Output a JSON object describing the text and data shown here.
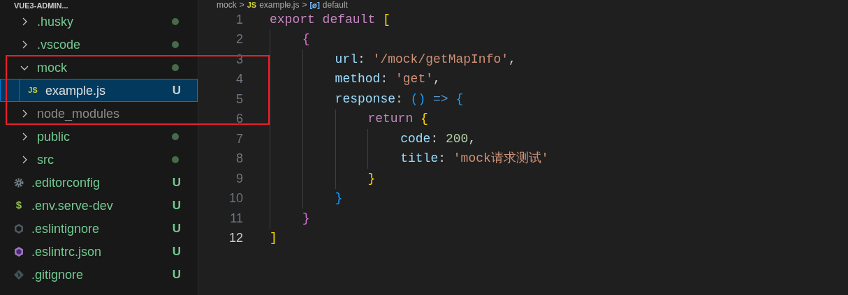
{
  "explorer": {
    "title": "VUE3-ADMIN...",
    "items": [
      {
        "name": ".husky",
        "kind": "folder",
        "expanded": false,
        "modified_dot": true,
        "ignored": false,
        "selected": false
      },
      {
        "name": ".vscode",
        "kind": "folder",
        "expanded": false,
        "modified_dot": true,
        "ignored": false,
        "selected": false
      },
      {
        "name": "mock",
        "kind": "folder",
        "expanded": true,
        "modified_dot": true,
        "ignored": false,
        "selected": false,
        "children": [
          {
            "name": "example.js",
            "kind": "js",
            "icon_text": "JS",
            "status": "U",
            "ignored": false,
            "selected": true
          }
        ]
      },
      {
        "name": "node_modules",
        "kind": "folder",
        "expanded": false,
        "ignored": true,
        "selected": false
      },
      {
        "name": "public",
        "kind": "folder",
        "expanded": false,
        "modified_dot": true,
        "ignored": false,
        "selected": false
      },
      {
        "name": "src",
        "kind": "folder",
        "expanded": false,
        "modified_dot": true,
        "ignored": false,
        "selected": false
      },
      {
        "name": ".editorconfig",
        "kind": "settings",
        "status": "U",
        "ignored": false,
        "selected": false
      },
      {
        "name": ".env.serve-dev",
        "kind": "env",
        "icon_text": "$",
        "status": "U",
        "ignored": false,
        "selected": false
      },
      {
        "name": ".eslintignore",
        "kind": "ignore",
        "status": "U",
        "ignored": false,
        "selected": false
      },
      {
        "name": ".eslintrc.json",
        "kind": "eslint",
        "status": "U",
        "ignored": false,
        "selected": false
      },
      {
        "name": ".gitignore",
        "kind": "git",
        "status": "U",
        "ignored": false,
        "selected": false
      }
    ]
  },
  "breadcrumb": [
    {
      "kind": "folder",
      "text": "mock"
    },
    {
      "kind": "separator",
      "text": ">"
    },
    {
      "kind": "file",
      "icon_text": "JS",
      "text": "example.js"
    },
    {
      "kind": "separator",
      "text": ">"
    },
    {
      "kind": "symbol",
      "icon_text": "[⌀]",
      "text": "default"
    }
  ],
  "editor": {
    "lines": [
      {
        "number": "1",
        "current": false,
        "tokens": [
          {
            "kind": "keyword",
            "text": "export default "
          },
          {
            "kind": "bracket1",
            "text": "["
          }
        ]
      },
      {
        "number": "2",
        "current": false,
        "tokens": [
          {
            "kind": "bracket2",
            "text": "    {"
          }
        ]
      },
      {
        "number": "3",
        "current": false,
        "tokens": [
          {
            "kind": "property",
            "text": "        url"
          },
          {
            "kind": "punct",
            "text": ": "
          },
          {
            "kind": "string",
            "text": "'/mock/getMapInfo'"
          },
          {
            "kind": "punct",
            "text": ","
          }
        ]
      },
      {
        "number": "4",
        "current": false,
        "tokens": [
          {
            "kind": "property",
            "text": "        method"
          },
          {
            "kind": "punct",
            "text": ": "
          },
          {
            "kind": "string",
            "text": "'get'"
          },
          {
            "kind": "punct",
            "text": ","
          }
        ]
      },
      {
        "number": "5",
        "current": false,
        "tokens": [
          {
            "kind": "property",
            "text": "        response"
          },
          {
            "kind": "punct",
            "text": ": "
          },
          {
            "kind": "bracket3",
            "text": "()"
          },
          {
            "kind": "operator",
            "text": " => "
          },
          {
            "kind": "bracket3",
            "text": "{"
          }
        ]
      },
      {
        "number": "6",
        "current": false,
        "tokens": [
          {
            "kind": "keyword",
            "text": "            return "
          },
          {
            "kind": "bracket1",
            "text": "{"
          }
        ]
      },
      {
        "number": "7",
        "current": false,
        "tokens": [
          {
            "kind": "property",
            "text": "                code"
          },
          {
            "kind": "punct",
            "text": ": "
          },
          {
            "kind": "number",
            "text": "200"
          },
          {
            "kind": "punct",
            "text": ","
          }
        ]
      },
      {
        "number": "8",
        "current": false,
        "tokens": [
          {
            "kind": "property",
            "text": "                title"
          },
          {
            "kind": "punct",
            "text": ": "
          },
          {
            "kind": "string",
            "text": "'mock请求测试'"
          }
        ]
      },
      {
        "number": "9",
        "current": false,
        "tokens": [
          {
            "kind": "bracket1",
            "text": "            }"
          }
        ]
      },
      {
        "number": "10",
        "current": false,
        "tokens": [
          {
            "kind": "bracket3",
            "text": "        }"
          }
        ]
      },
      {
        "number": "11",
        "current": false,
        "tokens": [
          {
            "kind": "bracket2",
            "text": "    }"
          }
        ]
      },
      {
        "number": "12",
        "current": true,
        "tokens": [
          {
            "kind": "bracket1",
            "text": "]"
          }
        ]
      }
    ]
  }
}
